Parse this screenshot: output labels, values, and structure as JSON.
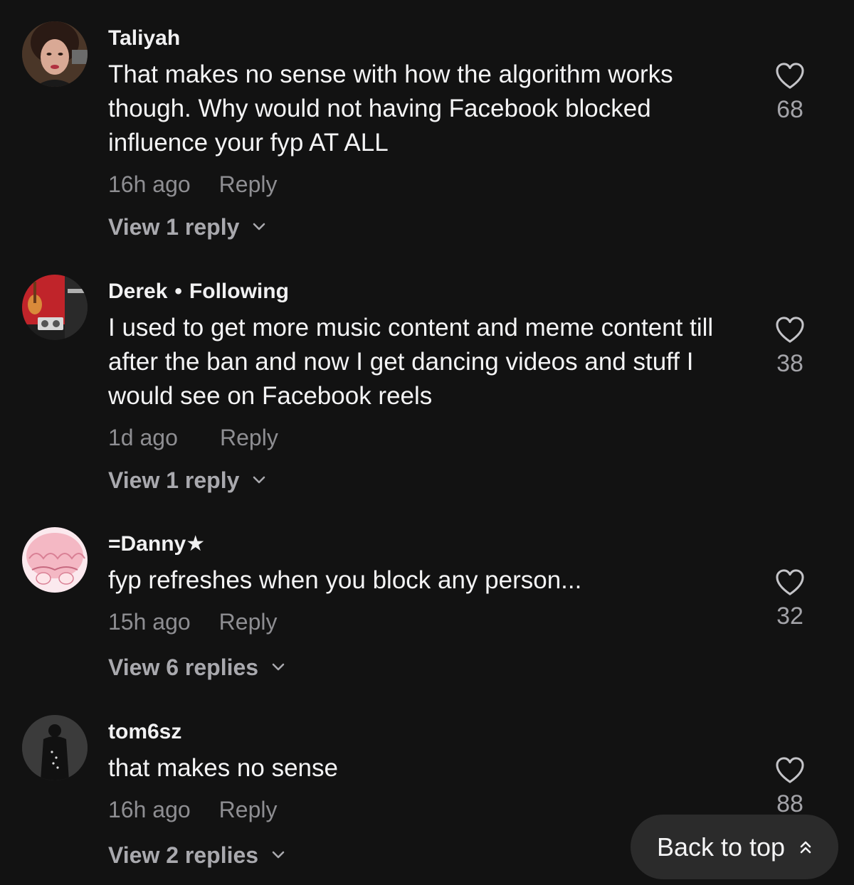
{
  "comments": [
    {
      "username": "Taliyah",
      "text": "That makes no sense with how the algorithm works though. Why would not having Facebook blocked influence your fyp AT ALL",
      "time": "16h ago",
      "reply_label": "Reply",
      "view_replies": "View 1 reply",
      "likes": "68"
    },
    {
      "username": "Derek",
      "badge": "Following",
      "text": "I used to get more music content and meme content till after the ban and now I get dancing videos and stuff I would see on Facebook reels",
      "time": "1d ago",
      "reply_label": "Reply",
      "view_replies": "View 1 reply",
      "likes": "38"
    },
    {
      "username": "=Danny★",
      "text": "fyp refreshes when you block any person...",
      "time": "15h ago",
      "reply_label": "Reply",
      "view_replies": "View 6 replies",
      "likes": "32"
    },
    {
      "username": "tom6sz",
      "text": "that makes no sense",
      "time": "16h ago",
      "reply_label": "Reply",
      "view_replies": "View 2 replies",
      "likes": "88"
    }
  ],
  "back_to_top": "Back to top",
  "colors": {
    "background": "#121212",
    "secondary_text": "#8e8e92",
    "button_bg": "#2b2b2b"
  },
  "icons": {
    "like": "heart-outline-icon",
    "expand": "chevron-down-icon",
    "scroll_top": "double-chevron-up-icon"
  }
}
